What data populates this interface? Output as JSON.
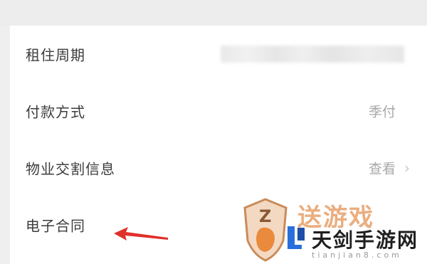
{
  "rows": [
    {
      "label": "租住周期",
      "value": "",
      "blurred": true
    },
    {
      "label": "付款方式",
      "value": "季付"
    },
    {
      "label": "物业交割信息",
      "value": "查看",
      "chevron": "›"
    },
    {
      "label": "电子合同",
      "value": ""
    }
  ],
  "watermark": {
    "top_text": "送游戏",
    "main_text": "天剑手游网",
    "sub_text": "tianjian8.com",
    "shield_letter": "Z"
  },
  "icons": {
    "arrow": "red-arrow-icon",
    "chevron": "chevron-right-icon",
    "shield": "shield-logo-icon"
  },
  "colors": {
    "arrow": "#e0302a",
    "watermark_orange": "#e7a16a"
  }
}
